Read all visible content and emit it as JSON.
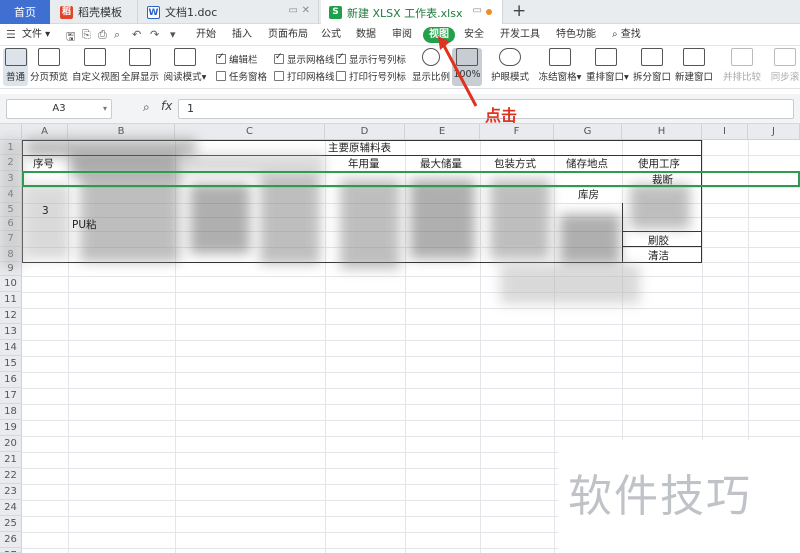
{
  "tabs": {
    "home": "首页",
    "template": "稻壳模板",
    "doc": "文档1.doc",
    "sheet": "新建 XLSX 工作表.xlsx",
    "new_tab": "+"
  },
  "menu": {
    "file": "文件",
    "items": [
      "开始",
      "插入",
      "页面布局",
      "公式",
      "数据",
      "审阅",
      "视图",
      "安全",
      "开发工具",
      "特色功能"
    ],
    "active": "视图",
    "search": "查找"
  },
  "ribbon": {
    "normal": "普通",
    "page_break": "分页预览",
    "custom_view": "自定义视图",
    "full_screen": "全屏显示",
    "reading_mode": "阅读模式",
    "edit_bar": "编辑栏",
    "task_pane": "任务窗格",
    "show_gridlines": "显示网格线",
    "print_gridlines": "打印网格线",
    "show_headings": "显示行号列标",
    "print_headings": "打印行号列标",
    "zoom": "显示比例",
    "zoom_100": "100%",
    "eye_mode": "护眼模式",
    "freeze": "冻结窗格",
    "arrange": "重排窗口",
    "split": "拆分窗口",
    "new_window": "新建窗口",
    "side_by_side": "并排比较",
    "sync_scroll": "同步滚"
  },
  "formula_bar": {
    "cell_ref": "A3",
    "fx": "fx",
    "value": "1"
  },
  "annotation": "点击",
  "columns": [
    "A",
    "B",
    "C",
    "D",
    "E",
    "F",
    "G",
    "H",
    "I",
    "J"
  ],
  "rows": [
    "1",
    "2",
    "3",
    "4",
    "5",
    "6",
    "7",
    "8",
    "9",
    "10",
    "11",
    "12",
    "13",
    "14",
    "15",
    "16",
    "17",
    "18",
    "19",
    "20",
    "21",
    "22",
    "23",
    "24",
    "25",
    "26",
    "27"
  ],
  "table": {
    "title": "主要原辅料表",
    "h_seq": "序号",
    "h_amount": "年用量",
    "h_max_store": "最大储量",
    "h_pack": "包装方式",
    "h_place": "储存地点",
    "h_process": "使用工序",
    "c_storage": "库房",
    "c_cut": "裁断",
    "c_pu": "PU粘",
    "c_seq3": "3",
    "c_glue": "刷胶",
    "c_clean": "清洁"
  },
  "watermark": "软件技巧"
}
